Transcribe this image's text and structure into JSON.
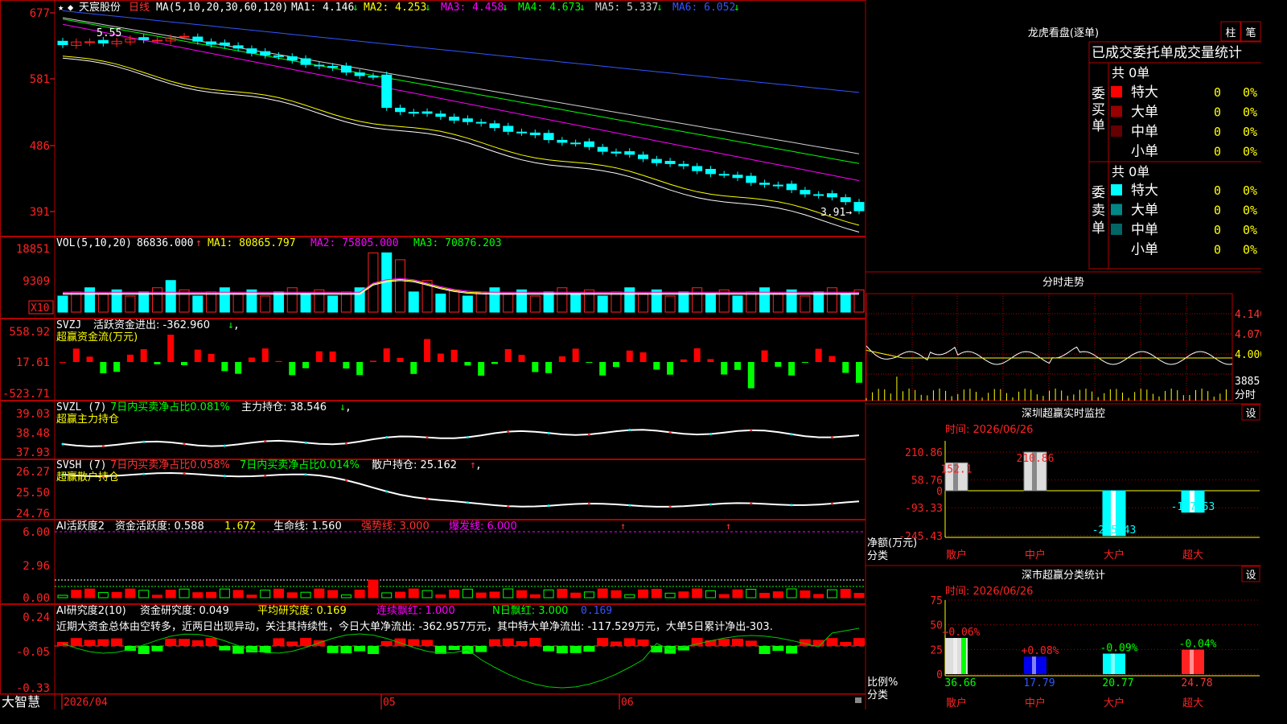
{
  "window": {
    "stock_name": "天宸股份",
    "period": "日线",
    "app_label": "大智慧",
    "dates": [
      "2026/04",
      "05",
      "06"
    ],
    "star": "★",
    "diamond": "◆"
  },
  "main_panel": {
    "ma_label": "MA(5,10,20,30,60,120)",
    "mas": [
      {
        "key": "MA1",
        "text": "MA1: 4.146",
        "arrow": "↓",
        "color": "#ffffff"
      },
      {
        "key": "MA2",
        "text": "MA2: 4.253",
        "arrow": "↓",
        "color": "#ffff00"
      },
      {
        "key": "MA3",
        "text": "MA3: 4.458",
        "arrow": "↓",
        "color": "#ff00ff"
      },
      {
        "key": "MA4",
        "text": "MA4: 4.673",
        "arrow": "↓",
        "color": "#00ff00"
      },
      {
        "key": "MA5",
        "text": "MA5: 5.337",
        "arrow": "↓",
        "color": "#d0d0d0"
      },
      {
        "key": "MA6",
        "text": "MA6: 6.052",
        "arrow": "↓",
        "color": "#3355ff"
      }
    ],
    "y_ticks": [
      "677",
      "581",
      "486",
      "391"
    ],
    "high_label": "5.55",
    "low_label": "3.91→"
  },
  "vol_panel": {
    "label": "VOL(5,10,20)",
    "value": "86836.000",
    "arrow": "↑",
    "ma1": "MA1: 80865.797",
    "ma2": "MA2: 75805.000",
    "ma3": "MA3: 70876.203",
    "y_ticks": [
      "18851",
      "9309"
    ],
    "unit": "X10"
  },
  "svzj_panel": {
    "label": "SVZJ",
    "text": "活跃资金进出: -362.960",
    "arrow": "↓",
    "comma": ",",
    "sub": "超赢资金流(万元)",
    "y_ticks": [
      "558.92",
      "17.61",
      "-523.71"
    ]
  },
  "svzl_panel": {
    "label": "SVZL (7)",
    "text1": "7日内买卖净占比0.081%",
    "text2": "主力持仓: 38.546",
    "arrow": "↓",
    "comma": ",",
    "sub": "超赢主力持仓",
    "y_ticks": [
      "39.03",
      "38.48",
      "37.93"
    ]
  },
  "svsh_panel": {
    "label": "SVSH (7)",
    "text1": "7日内买卖净占比0.058%",
    "text2": "7日内买卖净占比0.014%",
    "text3": "散户持仓: 25.162",
    "arrow": "↑",
    "comma": ",",
    "sub": "超赢散户持仓",
    "y_ticks": [
      "26.27",
      "25.50",
      "24.76"
    ]
  },
  "ai1_panel": {
    "label": "AI活跃度2",
    "t1": "资金活跃度: 0.588",
    "t2": "1.672",
    "t3": "生命线: 1.560",
    "t4": "强势线: 3.000",
    "t5": "爆发线: 6.000",
    "y_ticks": [
      "6.00",
      "2.96",
      "0.00"
    ]
  },
  "ai2_panel": {
    "label": "AI研究度2(10)",
    "t1": "资金研究度: 0.049",
    "t2": "平均研究度: 0.169",
    "t3": "连续飘红: 1.000",
    "t4": "N日飘红: 3.000",
    "t5": "0.169",
    "summary": "近期大资金总体由空转多，近两日出现异动，关注其持续性，今日大单净流出: -362.957万元，其中特大单净流出: -117.529万元，大单5日累计净出-303.",
    "y_ticks": [
      "0.24",
      "-0.05",
      "-0.33"
    ]
  },
  "right_top": {
    "title": "龙虎看盘(逐单)",
    "btn1": "柱",
    "btn2": "笔",
    "header": "已成交委托单成交量统计",
    "buy_label": [
      "委",
      "买",
      "单"
    ],
    "sell_label": [
      "委",
      "卖",
      "单"
    ],
    "buy_total": "共 0单",
    "sell_total": "共 0单",
    "buy_rows": [
      {
        "name": "特大",
        "qty": "0",
        "pct": "0%",
        "color": "#ff0000"
      },
      {
        "name": "大单",
        "qty": "0",
        "pct": "0%",
        "color": "#990000"
      },
      {
        "name": "中单",
        "qty": "0",
        "pct": "0%",
        "color": "#660000"
      },
      {
        "name": "小单",
        "qty": "0",
        "pct": "0%",
        "color": "#000000"
      }
    ],
    "sell_rows": [
      {
        "name": "特大",
        "qty": "0",
        "pct": "0%",
        "color": "#00ffff"
      },
      {
        "name": "大单",
        "qty": "0",
        "pct": "0%",
        "color": "#008888"
      },
      {
        "name": "中单",
        "qty": "0",
        "pct": "0%",
        "color": "#006666"
      },
      {
        "name": "小单",
        "qty": "0",
        "pct": "0%",
        "color": "#000000"
      }
    ]
  },
  "intraday": {
    "title": "分时走势",
    "y_ticks": [
      "4.140",
      "4.070",
      "4.000"
    ],
    "vol_label": "3885",
    "foot": "分时"
  },
  "sz_monitor": {
    "title": "深圳超赢实时监控",
    "btn": "设",
    "time": "时间: 2026/06/26",
    "y_ticks": [
      "210.86",
      "58.76",
      "0",
      "-93.33",
      "-245.43"
    ],
    "ylabel1": "净额(万元)",
    "ylabel2": "分类",
    "categories": [
      "散户",
      "中户",
      "大户",
      "超大"
    ],
    "values": [
      152.1,
      210.86,
      -245.43,
      -117.53
    ],
    "labels": [
      "152.1",
      "210.86",
      "-245.43",
      "-117.53"
    ]
  },
  "sz_stats": {
    "title": "深市超赢分类统计",
    "btn": "设",
    "time": "时间: 2026/06/26",
    "y_ticks": [
      "75",
      "50",
      "25",
      "0"
    ],
    "ylabel1": "比例%",
    "ylabel2": "分类",
    "categories": [
      "散户",
      "中户",
      "大户",
      "超大"
    ],
    "values": [
      36.66,
      17.79,
      20.77,
      24.78
    ],
    "changes": [
      "+0.06%",
      "+0.08%",
      "-0.09%",
      "-0.04%"
    ],
    "bottom_labels": [
      "36.66",
      "17.79",
      "20.77",
      "24.78"
    ]
  },
  "chart_data": {
    "type": "candlestick",
    "title": "天宸股份 日线",
    "x": [
      "2026/04",
      "05",
      "06"
    ],
    "close_last": 3.91,
    "high_label": 5.55,
    "ma": {
      "MA1": 4.146,
      "MA2": 4.253,
      "MA3": 4.458,
      "MA4": 4.673,
      "MA5": 5.337,
      "MA6": 6.052
    },
    "volume": {
      "VOL": 86836.0,
      "MA1": 80865.797,
      "MA2": 75805.0,
      "MA3": 70876.203
    }
  }
}
